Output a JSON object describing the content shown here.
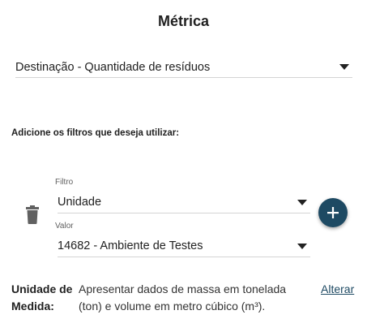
{
  "title": "Métrica",
  "metric_select": {
    "value": "Destinação - Quantidade de resíduos"
  },
  "filters_heading": "Adicione os filtros que deseja utilizar:",
  "filter": {
    "filter_label": "Filtro",
    "filter_value": "Unidade",
    "value_label": "Valor",
    "value_value": "14682 - Ambiente de Testes"
  },
  "unit": {
    "label": "Unidade de Medida:",
    "description": "Apresentar dados de massa em tonelada (ton) e volume em metro cúbico (m³).",
    "change_link": "Alterar"
  },
  "icons": {
    "dropdown": "chevron-down-icon",
    "delete": "trash-icon",
    "add": "plus-icon"
  },
  "colors": {
    "accent": "#1e4a63",
    "text": "#212121",
    "divider": "#d4d4d4"
  }
}
